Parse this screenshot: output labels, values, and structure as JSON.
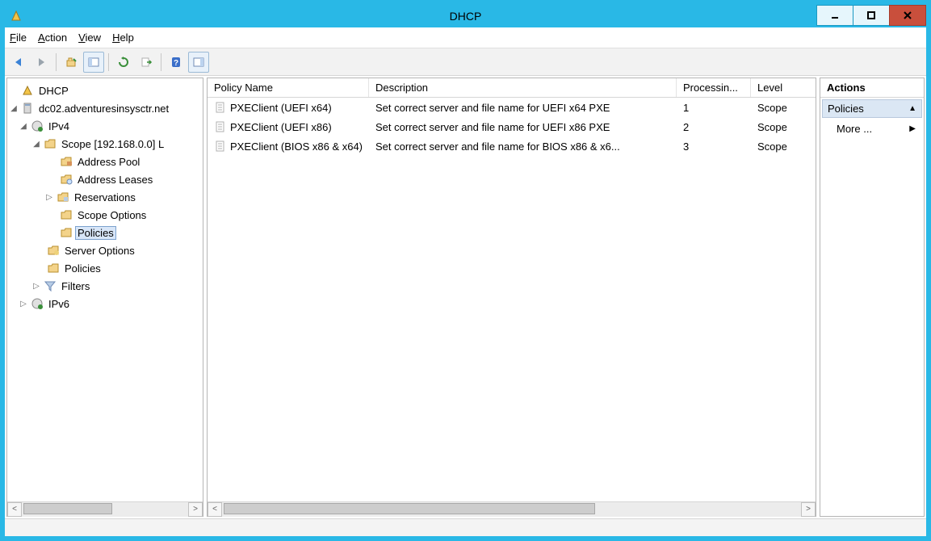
{
  "title": "DHCP",
  "menu": {
    "file": "File",
    "action": "Action",
    "view": "View",
    "help": "Help"
  },
  "toolbar": {
    "icons": [
      "back",
      "forward",
      "up",
      "show-hide",
      "refresh",
      "export",
      "help",
      "preview"
    ]
  },
  "tree": {
    "root": "DHCP",
    "server": "dc02.adventuresinsysctr.net",
    "ipv4": "IPv4",
    "scope": "Scope [192.168.0.0] L",
    "address_pool": "Address Pool",
    "address_leases": "Address Leases",
    "reservations": "Reservations",
    "scope_options": "Scope Options",
    "scope_policies": "Policies",
    "server_options": "Server Options",
    "server_policies": "Policies",
    "filters": "Filters",
    "ipv6": "IPv6"
  },
  "list": {
    "columns": {
      "name": "Policy Name",
      "desc": "Description",
      "proc": "Processin...",
      "level": "Level"
    },
    "rows": [
      {
        "name": "PXEClient (UEFI x64)",
        "desc": "Set correct server and file name for UEFI x64 PXE",
        "proc": "1",
        "level": "Scope"
      },
      {
        "name": "PXEClient (UEFI x86)",
        "desc": "Set correct server and file name for UEFI x86 PXE",
        "proc": "2",
        "level": "Scope"
      },
      {
        "name": "PXEClient (BIOS x86 & x64)",
        "desc": "Set correct server and file name for BIOS x86 & x6...",
        "proc": "3",
        "level": "Scope"
      }
    ]
  },
  "actions": {
    "header": "Actions",
    "group": "Policies",
    "more": "More ..."
  }
}
